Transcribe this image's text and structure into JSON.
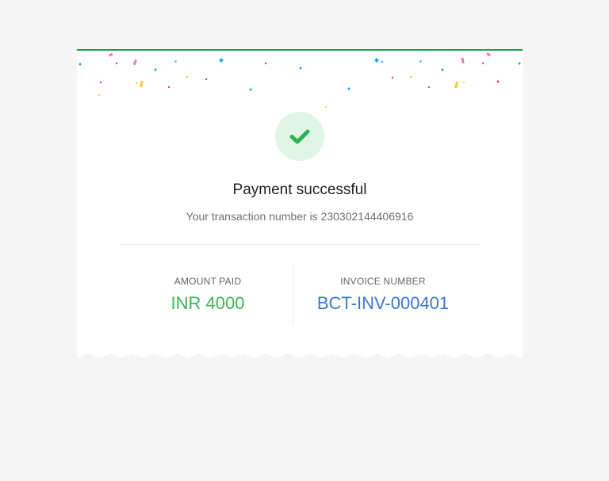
{
  "payment": {
    "title": "Payment successful",
    "transaction_text": "Your transaction number is 230302144406916"
  },
  "amount": {
    "label": "AMOUNT PAID",
    "value": "INR 4000"
  },
  "invoice": {
    "label": "INVOICE NUMBER",
    "value": "BCT-INV-000401"
  },
  "colors": {
    "accent": "#1aa14a",
    "success_text": "#3bb557",
    "link_blue": "#3a78d8",
    "check_bg": "#dff5e6"
  }
}
